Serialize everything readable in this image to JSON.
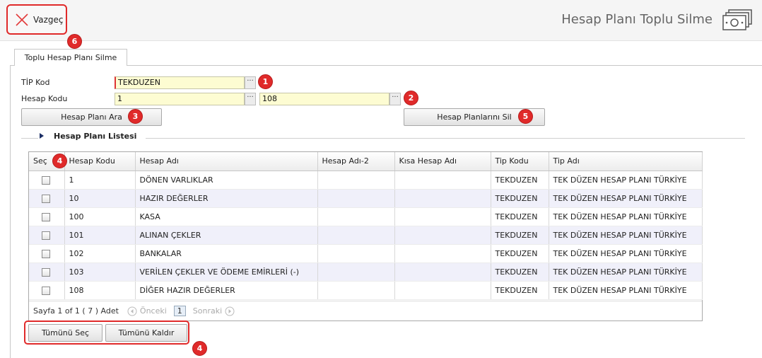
{
  "toolbar": {
    "cancel_label": "Vazgeç"
  },
  "header": {
    "title": "Hesap Planı Toplu Silme"
  },
  "tab": {
    "label": "Toplu Hesap Planı Silme"
  },
  "form": {
    "tip_kod_label": "TİP Kod",
    "tip_kod_value": "TEKDUZEN",
    "hesap_kodu_label": "Hesap Kodu",
    "hesap_kodu_from": "1",
    "hesap_kodu_to": "108",
    "trigger_glyph": "···"
  },
  "buttons": {
    "search": "Hesap Planı Ara",
    "delete": "Hesap Planlarını Sil",
    "select_all": "Tümünü Seç",
    "clear_all": "Tümünü Kaldır"
  },
  "section": {
    "title": "Hesap Planı Listesi"
  },
  "grid": {
    "columns": [
      "Seç",
      "Hesap Kodu",
      "Hesap Adı",
      "Hesap Adı-2",
      "Kısa Hesap Adı",
      "Tip Kodu",
      "Tip Adı"
    ],
    "rows": [
      {
        "kod": "1",
        "ad": "DÖNEN VARLIKLAR",
        "ad2": "",
        "kisa": "",
        "tip": "TEKDUZEN",
        "tip_adi": "TEK DÜZEN HESAP PLANI TÜRKİYE"
      },
      {
        "kod": "10",
        "ad": "HAZIR DEĞERLER",
        "ad2": "",
        "kisa": "",
        "tip": "TEKDUZEN",
        "tip_adi": "TEK DÜZEN HESAP PLANI TÜRKİYE"
      },
      {
        "kod": "100",
        "ad": "KASA",
        "ad2": "",
        "kisa": "",
        "tip": "TEKDUZEN",
        "tip_adi": "TEK DÜZEN HESAP PLANI TÜRKİYE"
      },
      {
        "kod": "101",
        "ad": "ALINAN ÇEKLER",
        "ad2": "",
        "kisa": "",
        "tip": "TEKDUZEN",
        "tip_adi": "TEK DÜZEN HESAP PLANI TÜRKİYE"
      },
      {
        "kod": "102",
        "ad": "BANKALAR",
        "ad2": "",
        "kisa": "",
        "tip": "TEKDUZEN",
        "tip_adi": "TEK DÜZEN HESAP PLANI TÜRKİYE"
      },
      {
        "kod": "103",
        "ad": "VERİLEN ÇEKLER VE ÖDEME EMİRLERİ (-)",
        "ad2": "",
        "kisa": "",
        "tip": "TEKDUZEN",
        "tip_adi": "TEK DÜZEN HESAP PLANI TÜRKİYE"
      },
      {
        "kod": "108",
        "ad": "DİĞER HAZIR DEĞERLER",
        "ad2": "",
        "kisa": "",
        "tip": "TEKDUZEN",
        "tip_adi": "TEK DÜZEN HESAP PLANI TÜRKİYE"
      }
    ]
  },
  "pager": {
    "summary": "Sayfa 1 of 1 ( 7 ) Adet",
    "prev": "Önceki",
    "page": "1",
    "next": "Sonraki"
  },
  "annotations": {
    "b1": "1",
    "b2": "2",
    "b3": "3",
    "b4a": "4",
    "b5": "5",
    "b6": "6",
    "b4b": "4"
  },
  "colors": {
    "annotation_red": "#e02a2a",
    "field_bg": "#fdfcd2",
    "row_alt": "#f0f0fa"
  }
}
